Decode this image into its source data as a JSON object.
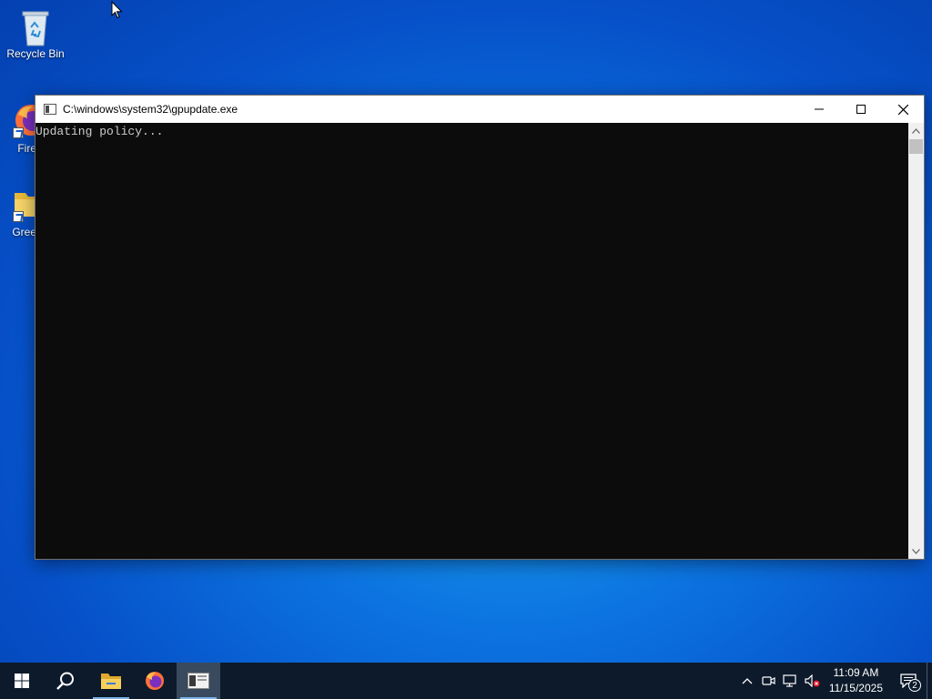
{
  "desktop": {
    "icons": [
      {
        "label": "Recycle Bin"
      },
      {
        "label": "Fire"
      },
      {
        "label": "Gree"
      }
    ]
  },
  "window": {
    "title": "C:\\windows\\system32\\gpupdate.exe",
    "console_text": "Updating policy..."
  },
  "taskbar": {
    "clock_time": "11:09 AM",
    "clock_date": "11/15/2025",
    "notification_count": "2"
  },
  "colors": {
    "taskbar_bg": "#0d1a2b",
    "console_bg": "#0c0c0c",
    "console_text": "#cccccc"
  }
}
